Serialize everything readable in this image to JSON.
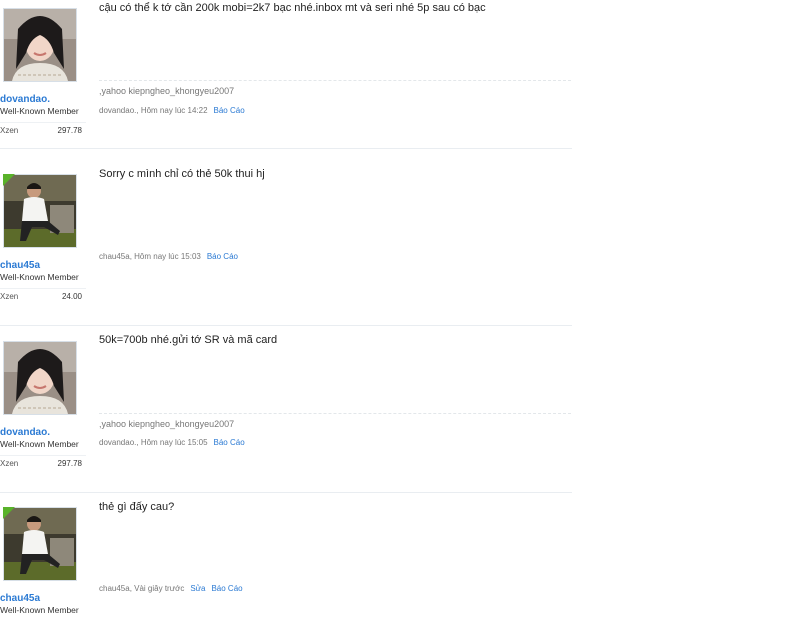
{
  "posts": [
    {
      "username": "dovandao.",
      "user_title": "Well-Known Member",
      "stat_label": "Xzen",
      "stat_value": "297.78",
      "message": "cậu có thể k tớ cần 200k mobi=2k7 bạc nhé.inbox mt và seri nhé 5p sau có bạc",
      "signature": ",yahoo kiepngheo_khongyeu2007",
      "meta": "dovandao., Hôm nay lúc 14:22",
      "report_label": "Báo Cáo",
      "avatar_icon": "avatar-girl-photo",
      "online": false
    },
    {
      "username": "chau45a",
      "user_title": "Well-Known Member",
      "stat_label": "Xzen",
      "stat_value": "24.00",
      "message": "Sorry c mình chỉ có thẻ 50k thui hj",
      "signature": "",
      "meta": "chau45a, Hôm nay lúc 15:03",
      "report_label": "Báo Cáo",
      "avatar_icon": "avatar-boy-photo",
      "online": true
    },
    {
      "username": "dovandao.",
      "user_title": "Well-Known Member",
      "stat_label": "Xzen",
      "stat_value": "297.78",
      "message": "50k=700b nhé.gửi tớ SR và mã card",
      "signature": ",yahoo kiepngheo_khongyeu2007",
      "meta": "dovandao., Hôm nay lúc 15:05",
      "report_label": "Báo Cáo",
      "avatar_icon": "avatar-girl-photo",
      "online": false
    },
    {
      "username": "chau45a",
      "user_title": "Well-Known Member",
      "message": "thẻ gì đấy cau?",
      "meta": "chau45a, Vài giây trước",
      "edit_label": "Sửa",
      "report_label": "Báo Cáo",
      "avatar_icon": "avatar-boy-photo",
      "online": true
    }
  ]
}
